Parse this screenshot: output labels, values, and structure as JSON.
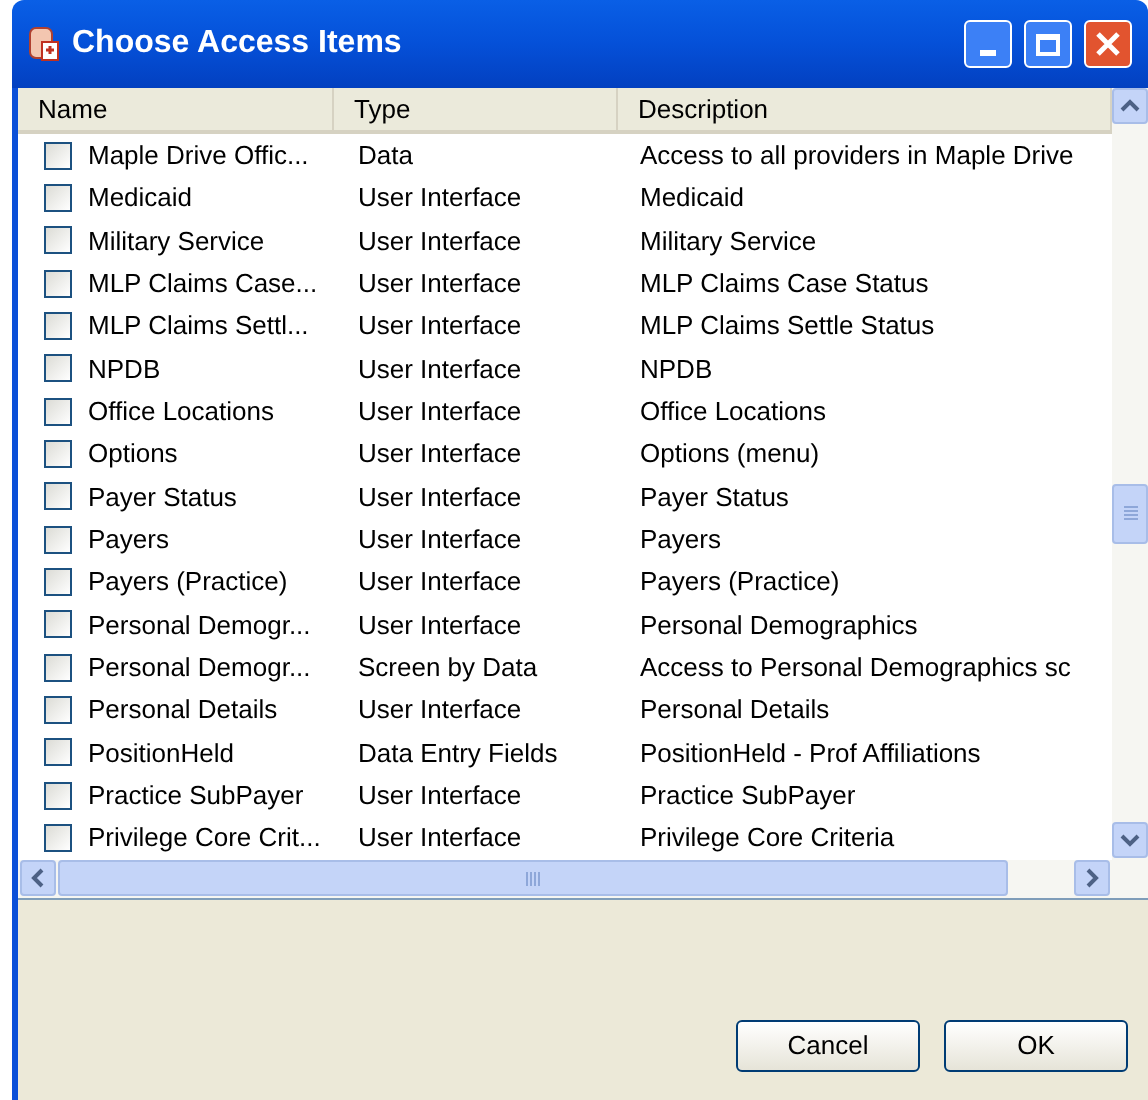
{
  "window": {
    "title": "Choose Access Items"
  },
  "table": {
    "columns": [
      "Name",
      "Type",
      "Description"
    ],
    "rows": [
      {
        "name": "Maple Drive Offic...",
        "type": "Data",
        "description": "Access to all providers in Maple Drive",
        "checked": false
      },
      {
        "name": "Medicaid",
        "type": "User Interface",
        "description": "Medicaid",
        "checked": false
      },
      {
        "name": "Military Service",
        "type": "User Interface",
        "description": "Military Service",
        "checked": false
      },
      {
        "name": "MLP Claims Case...",
        "type": "User Interface",
        "description": "MLP Claims Case Status",
        "checked": false
      },
      {
        "name": "MLP Claims Settl...",
        "type": "User Interface",
        "description": "MLP Claims Settle Status",
        "checked": false
      },
      {
        "name": "NPDB",
        "type": "User Interface",
        "description": "NPDB",
        "checked": false
      },
      {
        "name": "Office Locations",
        "type": "User Interface",
        "description": "Office Locations",
        "checked": false
      },
      {
        "name": "Options",
        "type": "User Interface",
        "description": "Options (menu)",
        "checked": false
      },
      {
        "name": "Payer Status",
        "type": "User Interface",
        "description": "Payer Status",
        "checked": false
      },
      {
        "name": "Payers",
        "type": "User Interface",
        "description": "Payers",
        "checked": false
      },
      {
        "name": "Payers (Practice)",
        "type": "User Interface",
        "description": "Payers (Practice)",
        "checked": false
      },
      {
        "name": "Personal Demogr...",
        "type": "User Interface",
        "description": "Personal Demographics",
        "checked": false
      },
      {
        "name": "Personal Demogr...",
        "type": "Screen by Data",
        "description": "Access to Personal Demographics sc",
        "checked": false
      },
      {
        "name": "Personal Details",
        "type": "User Interface",
        "description": "Personal Details",
        "checked": false
      },
      {
        "name": "PositionHeld",
        "type": "Data Entry Fields",
        "description": "PositionHeld - Prof Affiliations",
        "checked": false
      },
      {
        "name": "Practice SubPayer",
        "type": "User Interface",
        "description": "Practice SubPayer",
        "checked": false
      },
      {
        "name": "Privilege Core Crit...",
        "type": "User Interface",
        "description": "Privilege Core Criteria",
        "checked": false
      }
    ]
  },
  "buttons": [
    "Cancel",
    "OK"
  ]
}
